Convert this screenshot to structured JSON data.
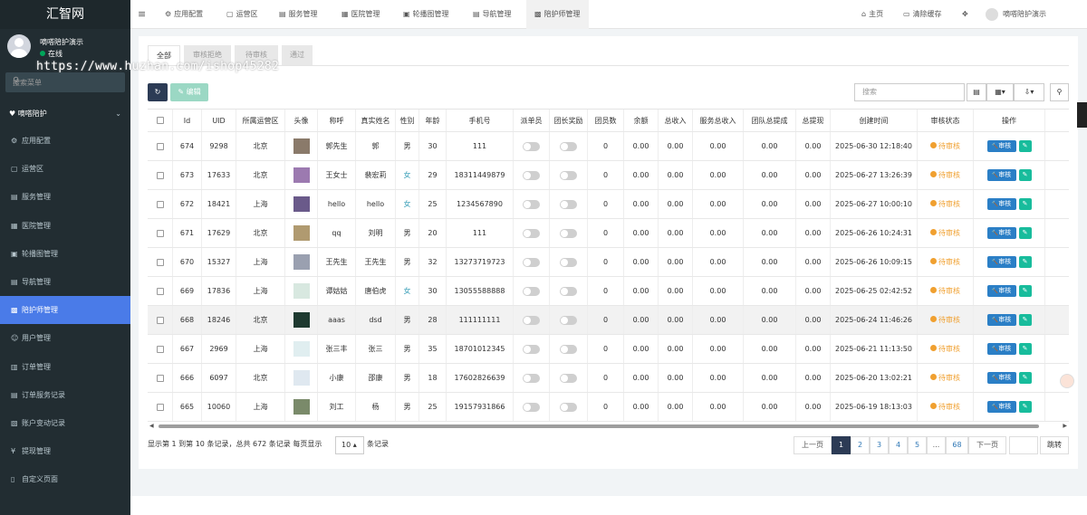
{
  "sidebar": {
    "logo": "汇智网",
    "user_name": "嘀嗒陪护演示",
    "user_status": "在线",
    "search_placeholder": "搜索菜单",
    "group_title": "嘀嗒陪护",
    "items": [
      {
        "label": "应用配置",
        "icon": "gear-icon"
      },
      {
        "label": "运营区",
        "icon": "map-icon"
      },
      {
        "label": "服务管理",
        "icon": "list-icon"
      },
      {
        "label": "医院管理",
        "icon": "building-icon"
      },
      {
        "label": "轮播图管理",
        "icon": "image-icon"
      },
      {
        "label": "导航管理",
        "icon": "nav-icon"
      },
      {
        "label": "陪护师管理",
        "icon": "id-card-icon"
      },
      {
        "label": "用户管理",
        "icon": "user-icon"
      },
      {
        "label": "订单管理",
        "icon": "order-icon"
      },
      {
        "label": "订单服务记录",
        "icon": "record-icon"
      },
      {
        "label": "账户变动记录",
        "icon": "account-icon"
      },
      {
        "label": "提现管理",
        "icon": "yen-icon"
      },
      {
        "label": "自定义页面",
        "icon": "page-icon"
      }
    ]
  },
  "watermark": "https://www.huzhan.com/ishop45282",
  "topbar": {
    "menu_icon": "≡",
    "tabs": [
      "应用配置",
      "运营区",
      "服务管理",
      "医院管理",
      "轮播图管理",
      "导航管理",
      "陪护师管理"
    ],
    "home": "主页",
    "clear_cache": "清除缓存",
    "user": "嘀嗒陪护演示"
  },
  "filter_tabs": [
    "全部",
    "审核拒绝",
    "待审核",
    "通过"
  ],
  "toolbar": {
    "edit_label": "编辑",
    "search_placeholder": "搜索"
  },
  "table": {
    "headers": [
      "Id",
      "UID",
      "所属运营区",
      "头像",
      "称呼",
      "真实姓名",
      "性别",
      "年龄",
      "手机号",
      "派单员",
      "团长奖励",
      "团员数",
      "余额",
      "总收入",
      "服务总收入",
      "团队总提成",
      "总提现",
      "创建时间",
      "审核状态",
      "操作"
    ],
    "audit_label": "审核",
    "rows": [
      {
        "id": "674",
        "uid": "9298",
        "region": "北京",
        "nick": "郭先生",
        "name": "郭",
        "gender": "男",
        "age": "30",
        "phone": "111",
        "members": "0",
        "balance": "0.00",
        "income": "0.00",
        "service_income": "0.00",
        "team_commission": "0.00",
        "withdraw": "0.00",
        "created": "2025-06-30 12:18:40",
        "status": "待审核"
      },
      {
        "id": "673",
        "uid": "17633",
        "region": "北京",
        "nick": "王女士",
        "name": "裴宏莉",
        "gender": "女",
        "age": "29",
        "phone": "18311449879",
        "members": "0",
        "balance": "0.00",
        "income": "0.00",
        "service_income": "0.00",
        "team_commission": "0.00",
        "withdraw": "0.00",
        "created": "2025-06-27 13:26:39",
        "status": "待审核"
      },
      {
        "id": "672",
        "uid": "18421",
        "region": "上海",
        "nick": "hello",
        "name": "hello",
        "gender": "女",
        "age": "25",
        "phone": "1234567890",
        "members": "0",
        "balance": "0.00",
        "income": "0.00",
        "service_income": "0.00",
        "team_commission": "0.00",
        "withdraw": "0.00",
        "created": "2025-06-27 10:00:10",
        "status": "待审核"
      },
      {
        "id": "671",
        "uid": "17629",
        "region": "北京",
        "nick": "qq",
        "name": "刘明",
        "gender": "男",
        "age": "20",
        "phone": "111",
        "members": "0",
        "balance": "0.00",
        "income": "0.00",
        "service_income": "0.00",
        "team_commission": "0.00",
        "withdraw": "0.00",
        "created": "2025-06-26 10:24:31",
        "status": "待审核"
      },
      {
        "id": "670",
        "uid": "15327",
        "region": "上海",
        "nick": "王先生",
        "name": "王先生",
        "gender": "男",
        "age": "32",
        "phone": "13273719723",
        "members": "0",
        "balance": "0.00",
        "income": "0.00",
        "service_income": "0.00",
        "team_commission": "0.00",
        "withdraw": "0.00",
        "created": "2025-06-26 10:09:15",
        "status": "待审核"
      },
      {
        "id": "669",
        "uid": "17836",
        "region": "上海",
        "nick": "谭姑姑",
        "name": "唐伯虎",
        "gender": "女",
        "age": "30",
        "phone": "13055588888",
        "members": "0",
        "balance": "0.00",
        "income": "0.00",
        "service_income": "0.00",
        "team_commission": "0.00",
        "withdraw": "0.00",
        "created": "2025-06-25 02:42:52",
        "status": "待审核"
      },
      {
        "id": "668",
        "uid": "18246",
        "region": "北京",
        "nick": "aaas",
        "name": "dsd",
        "gender": "男",
        "age": "28",
        "phone": "111111111",
        "members": "0",
        "balance": "0.00",
        "income": "0.00",
        "service_income": "0.00",
        "team_commission": "0.00",
        "withdraw": "0.00",
        "created": "2025-06-24 11:46:26",
        "status": "待审核"
      },
      {
        "id": "667",
        "uid": "2969",
        "region": "上海",
        "nick": "张三丰",
        "name": "张三",
        "gender": "男",
        "age": "35",
        "phone": "18701012345",
        "members": "0",
        "balance": "0.00",
        "income": "0.00",
        "service_income": "0.00",
        "team_commission": "0.00",
        "withdraw": "0.00",
        "created": "2025-06-21 11:13:50",
        "status": "待审核"
      },
      {
        "id": "666",
        "uid": "6097",
        "region": "北京",
        "nick": "小康",
        "name": "邵康",
        "gender": "男",
        "age": "18",
        "phone": "17602826639",
        "members": "0",
        "balance": "0.00",
        "income": "0.00",
        "service_income": "0.00",
        "team_commission": "0.00",
        "withdraw": "0.00",
        "created": "2025-06-20 13:02:21",
        "status": "待审核"
      },
      {
        "id": "665",
        "uid": "10060",
        "region": "上海",
        "nick": "刘工",
        "name": "杨",
        "gender": "男",
        "age": "25",
        "phone": "19157931866",
        "members": "0",
        "balance": "0.00",
        "income": "0.00",
        "service_income": "0.00",
        "team_commission": "0.00",
        "withdraw": "0.00",
        "created": "2025-06-19 18:13:03",
        "status": "待审核"
      }
    ]
  },
  "footer": {
    "info": "显示第 1 到第 10 条记录，总共 672 条记录 每页显示",
    "per_page": "10",
    "suffix": "条记录",
    "pages": [
      "上一页",
      "1",
      "2",
      "3",
      "4",
      "5",
      "...",
      "68",
      "下一页"
    ],
    "jump": "跳转"
  },
  "colors": {
    "sidebar": "#222d32",
    "active_menu": "#4a7be8",
    "pending": "#f0a030",
    "audit_btn": "#2b7fc6",
    "edit_btn": "#18bc9c"
  }
}
